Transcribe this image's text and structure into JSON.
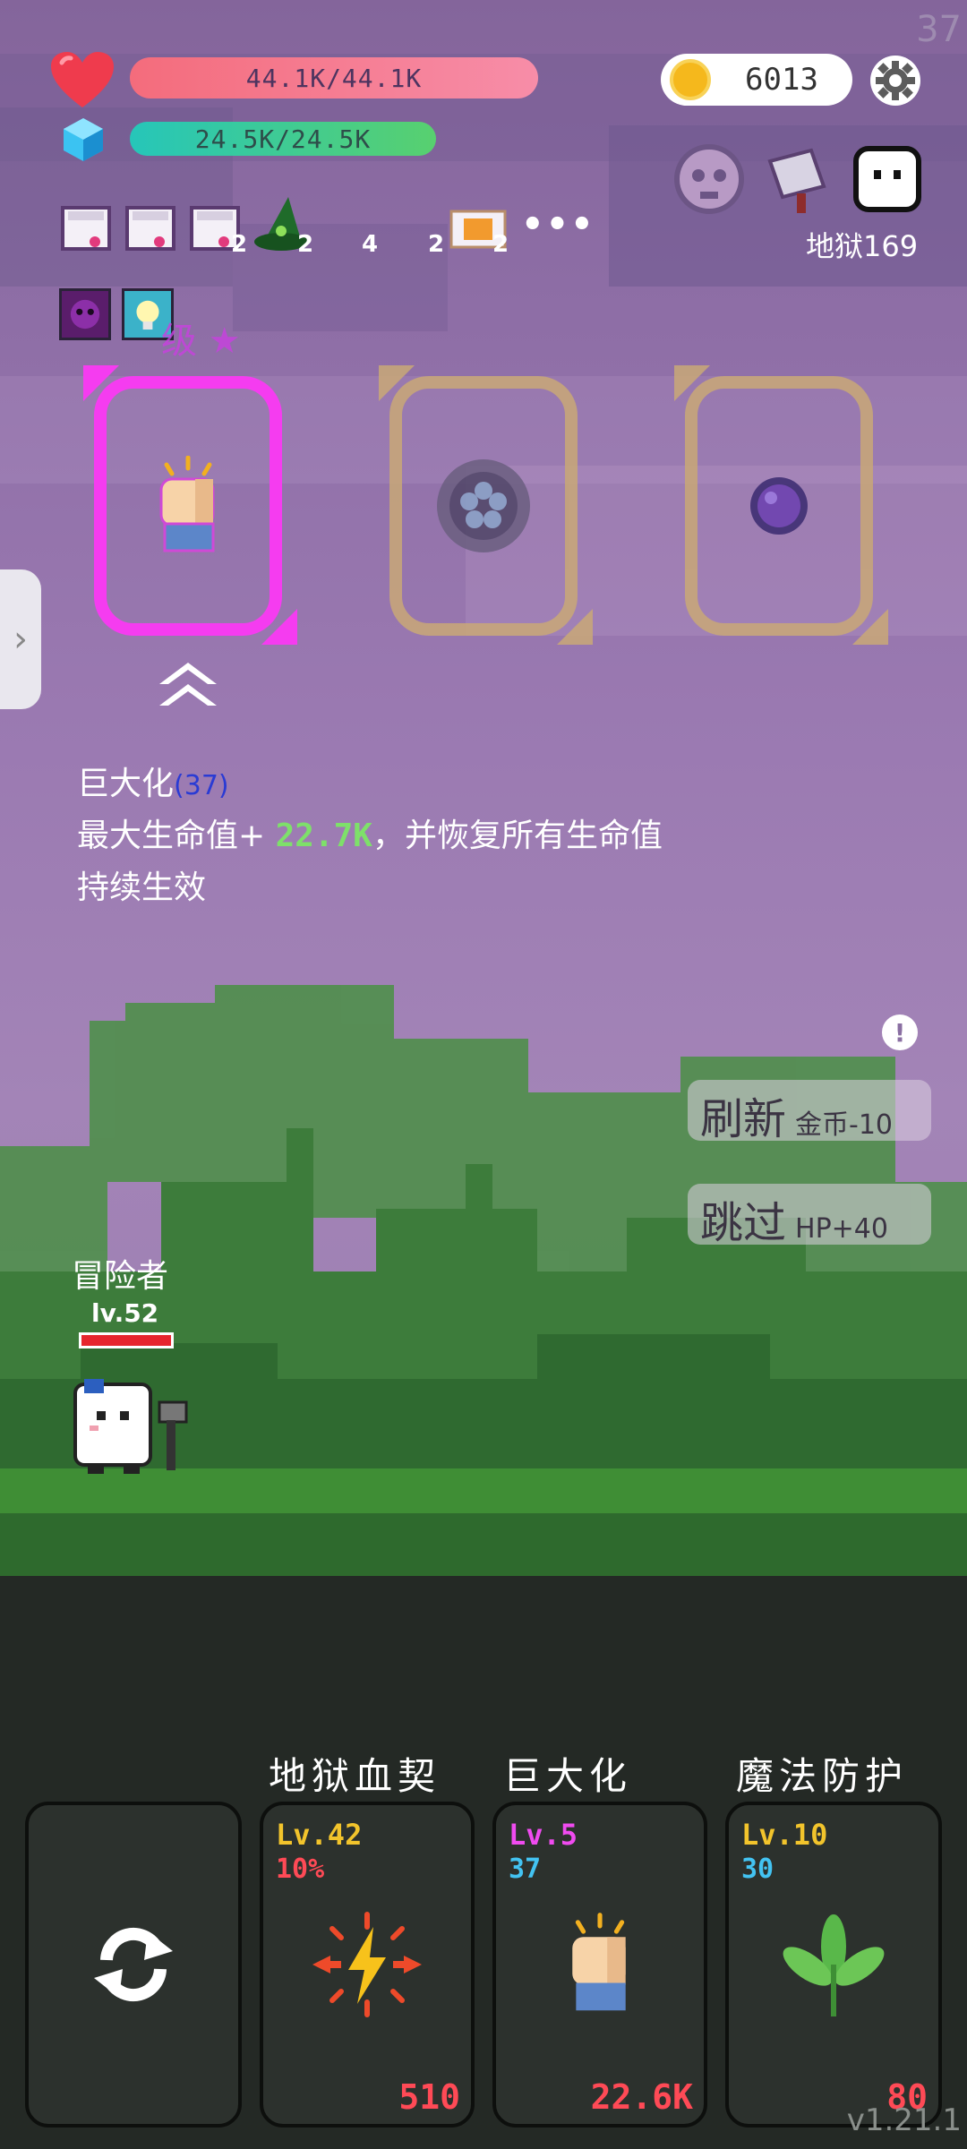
{
  "corner_number": "37",
  "hp": {
    "text": "44.1K/44.1K"
  },
  "mp": {
    "text": "24.5K/24.5K"
  },
  "gold": {
    "value": "6013"
  },
  "inventory": {
    "counts": [
      "2",
      "2",
      "4",
      "2",
      "2"
    ],
    "more": "•••"
  },
  "stage": {
    "label": "地狱169"
  },
  "selection": {
    "star_text": "级 ★"
  },
  "description": {
    "title": "巨大化",
    "level_open": "(",
    "level": "37",
    "level_close": ")",
    "line_prefix": "最大生命值+ ",
    "line_value": "22.7K",
    "line_suffix": "，并恢复所有生命值",
    "duration": "持续生效"
  },
  "info_icon": "!",
  "actions": {
    "refresh": {
      "label": "刷新",
      "cost": "金币-10"
    },
    "skip": {
      "label": "跳过",
      "cost": "HP+40"
    }
  },
  "hero": {
    "name": "冒险者",
    "level": "lv.52"
  },
  "skills": [
    {
      "name": "地狱血契",
      "level": "Lv.42",
      "sub": "10%",
      "cost": "510",
      "level_color": "#f2c42c",
      "sub_color": "#ff4a56",
      "icon": "lightning-icon"
    },
    {
      "name": "巨大化",
      "level": "Lv.5",
      "sub": "37",
      "cost": "22.6K",
      "level_color": "#f04bf0",
      "sub_color": "#43c3f2",
      "icon": "fist-icon"
    },
    {
      "name": "魔法防护",
      "level": "Lv.10",
      "sub": "30",
      "cost": "80",
      "level_color": "#f2c42c",
      "sub_color": "#43c3f2",
      "icon": "leaf-icon"
    }
  ],
  "version": "v1.21.1",
  "colors": {
    "accent_selected": "#f53cf0",
    "card_border": "#c9a877",
    "hp": "#f46c7c",
    "mp": "#26c6b9"
  }
}
